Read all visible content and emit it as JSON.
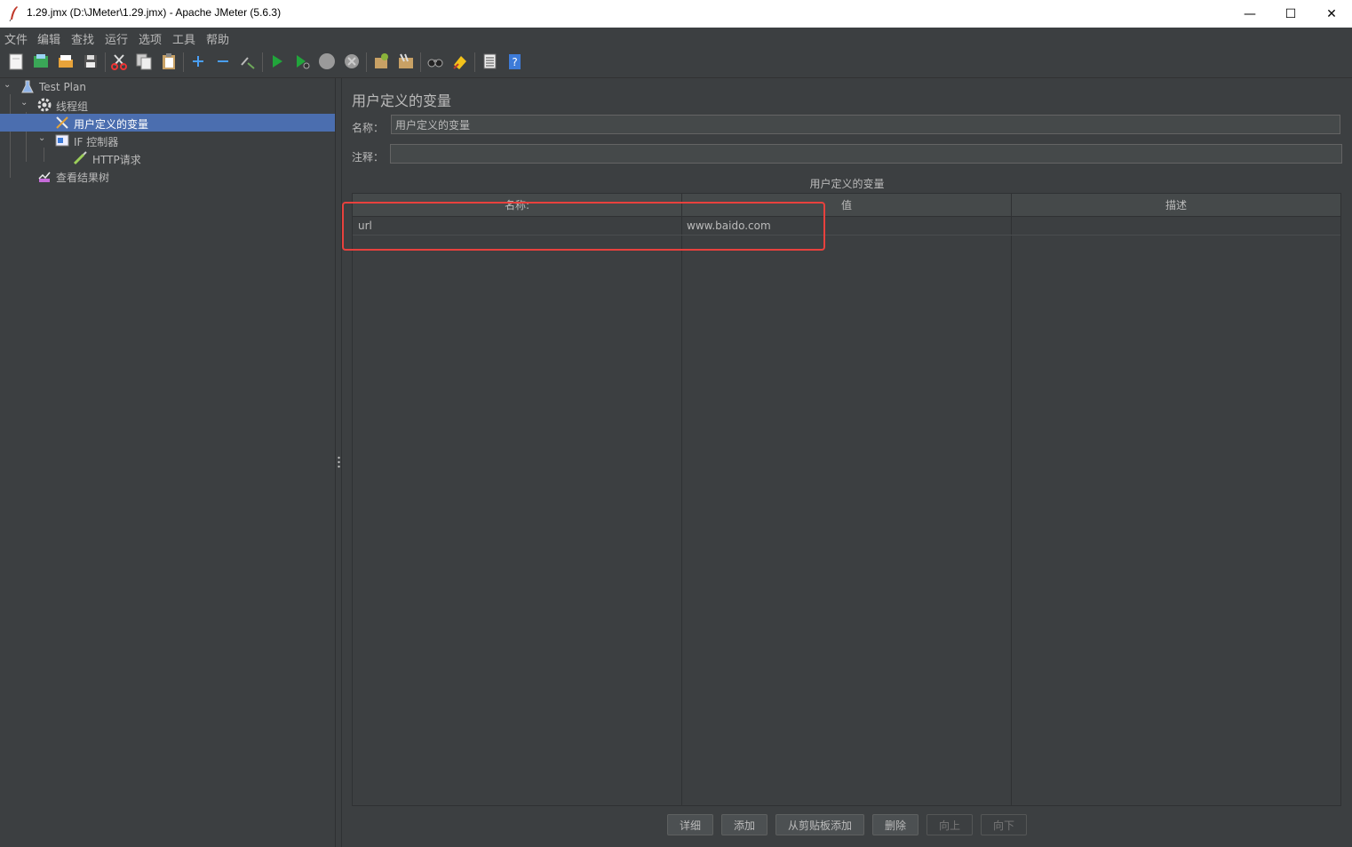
{
  "window": {
    "title": "1.29.jmx (D:\\JMeter\\1.29.jmx) - Apache JMeter (5.6.3)",
    "controls": {
      "minimize": "—",
      "maximize": "☐",
      "close": "✕"
    }
  },
  "menu": [
    "文件",
    "编辑",
    "查找",
    "运行",
    "选项",
    "工具",
    "帮助"
  ],
  "toolbar": {
    "icons": [
      "new-icon",
      "templates-icon",
      "open-icon",
      "save-icon",
      "cut-icon",
      "copy-icon",
      "paste-icon",
      "expand-icon",
      "collapse-icon",
      "toggle-icon",
      "start-icon",
      "start-no-pause-icon",
      "stop-icon",
      "shutdown-icon",
      "clear-icon",
      "clear-all-icon",
      "search-icon",
      "reset-search-icon",
      "function-helper-icon",
      "help-icon"
    ]
  },
  "tree": {
    "items": [
      {
        "label": "Test Plan"
      },
      {
        "label": "线程组"
      },
      {
        "label": "用户定义的变量"
      },
      {
        "label": "IF 控制器"
      },
      {
        "label": "HTTP请求"
      },
      {
        "label": "查看结果树"
      }
    ]
  },
  "panel": {
    "title": "用户定义的变量",
    "name_label": "名称：",
    "name_value": "用户定义的变量",
    "comment_label": "注释：",
    "comment_value": "",
    "section_title": "用户定义的变量"
  },
  "table": {
    "columns": [
      "名称:",
      "值",
      "描述"
    ],
    "rows": [
      {
        "name": "url",
        "value": "www.baido.com",
        "desc": ""
      }
    ]
  },
  "buttons": {
    "detail": "详细",
    "add": "添加",
    "add_from_clipboard": "从剪贴板添加",
    "delete": "删除",
    "up": "向上",
    "down": "向下"
  },
  "colors": {
    "background": "#3c3f41",
    "selection": "#4b6eaf",
    "highlight": "#e8413d"
  }
}
